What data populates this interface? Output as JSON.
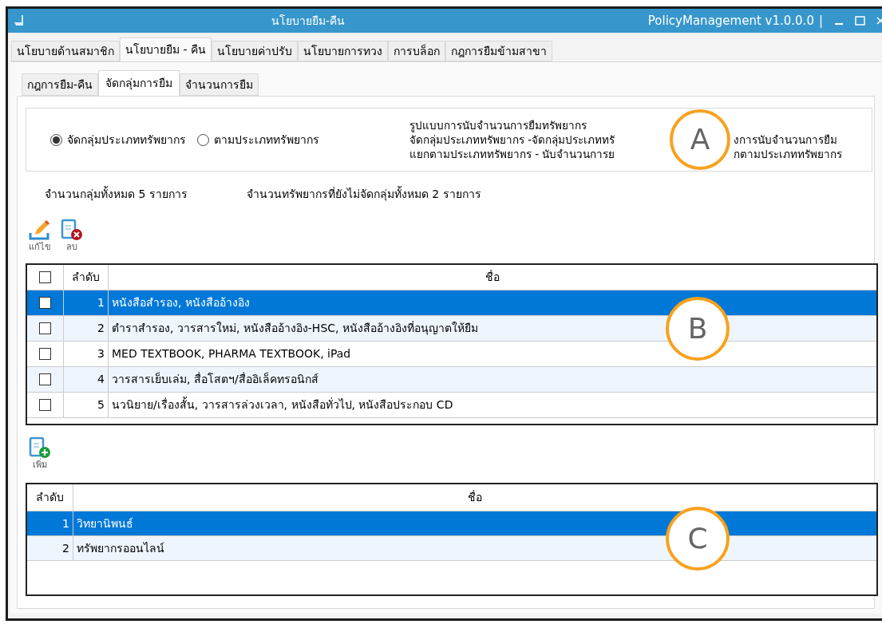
{
  "window": {
    "title": "นโยบายยืม-คืน",
    "app_name": "PolicyManagement v1.0.0.0",
    "separator": "|"
  },
  "tabs": [
    {
      "label": "นโยบายด้านสมาชิก",
      "selected": false
    },
    {
      "label": "นโยบายยืม - คืน",
      "selected": true
    },
    {
      "label": "นโยบายค่าปรับ",
      "selected": false
    },
    {
      "label": "นโยบายการทวง",
      "selected": false
    },
    {
      "label": "การบล็อก",
      "selected": false
    },
    {
      "label": "กฎการยืมข้ามสาขา",
      "selected": false
    }
  ],
  "sub_tabs": [
    {
      "label": "กฎการยืม-คืน",
      "selected": false
    },
    {
      "label": "จัดกลุ่มการยืม",
      "selected": true
    },
    {
      "label": "จำนวนการยืม",
      "selected": false
    }
  ],
  "mode": {
    "options": [
      {
        "label": "จัดกลุ่มประเภททรัพยากร",
        "selected": true
      },
      {
        "label": "ตามประเภททรัพยากร",
        "selected": false
      }
    ],
    "description": {
      "heading": "รูปแบบการนับจำนวนการยืมทรัพยากร",
      "lines": [
        {
          "left": "จัดกลุ่มประเภททรัพยากร -จัดกลุ่มประเภททรั",
          "right": "งการนับจำนวนการยืม"
        },
        {
          "left": "แยกตามประเภททรัพยากร - นับจำนวนการย",
          "right": "กตามประเภททรัพยากร"
        }
      ],
      "callout": "A"
    }
  },
  "summary": {
    "groups_total": "จำนวนกลุ่มทั้งหมด 5 รายการ",
    "ungrouped_total": "จำนวนทรัพยากรที่ยังไม่จัดกลุ่มทั้งหมด 2 รายการ"
  },
  "groups_toolbar": [
    {
      "kind": "edit",
      "label": "แก้ไข"
    },
    {
      "kind": "delete",
      "label": "ลบ"
    }
  ],
  "groups_table": {
    "header_checked": false,
    "columns": [
      "ลำดับ",
      "ชื่อ"
    ],
    "callout": "B",
    "rows": [
      {
        "no": "1",
        "name": "หนังสือสำรอง, หนังสืออ้างอิง",
        "checked": false,
        "selected": true
      },
      {
        "no": "2",
        "name": "ตำราสำรอง, วารสารใหม่, หนังสืออ้างอิง-HSC, หนังสืออ้างอิงที่อนุญาตให้ยืม",
        "checked": false,
        "selected": false
      },
      {
        "no": "3",
        "name": "MED TEXTBOOK, PHARMA TEXTBOOK, iPad",
        "checked": false,
        "selected": false
      },
      {
        "no": "4",
        "name": "วารสารเย็บเล่ม, สื่อโสตฯ/สื่ออิเล็คทรอนิกส์",
        "checked": false,
        "selected": false
      },
      {
        "no": "5",
        "name": "นวนิยาย/เรื่องสั้น, วารสารล่วงเวลา, หนังสือทั่วไป, หนังสือประกอบ CD",
        "checked": false,
        "selected": false
      }
    ]
  },
  "ungrouped_toolbar": [
    {
      "kind": "add",
      "label": "เพิ่ม"
    }
  ],
  "ungrouped_table": {
    "columns": [
      "ลำดับ",
      "ชื่อ"
    ],
    "callout": "C",
    "rows": [
      {
        "no": "1",
        "name": "วิทยานิพนธ์",
        "selected": true
      },
      {
        "no": "2",
        "name": "ทรัพยากรออนไลน์",
        "selected": false
      }
    ]
  }
}
